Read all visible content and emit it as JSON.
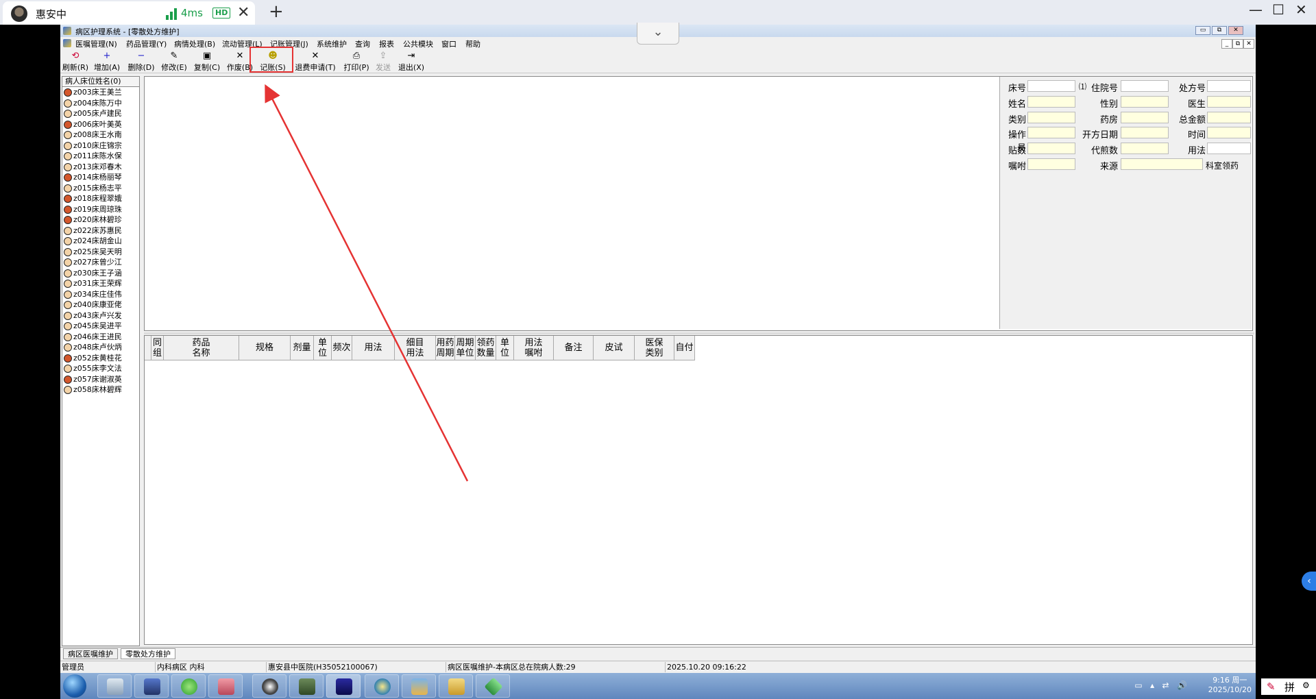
{
  "client": {
    "tab_title": "惠安中",
    "latency": "4ms",
    "quality": "HD",
    "close": "✕",
    "add": "+",
    "minimize": "—",
    "maximize": "☐",
    "close_window": "✕",
    "collapse": "⌄"
  },
  "window": {
    "title": "病区护理系统 - [零散处方维护]"
  },
  "menu": [
    "医嘱管理(N)",
    "药品管理(Y)",
    "病情处理(B)",
    "流动管理(L)",
    "记账管理(J)",
    "系统维护",
    "查询",
    "报表",
    "公共模块",
    "窗口",
    "帮助"
  ],
  "toolbar": [
    {
      "label": "刷新(R)",
      "icon": "⟲",
      "enabled": true
    },
    {
      "label": "增加(A)",
      "icon": "+",
      "enabled": true
    },
    {
      "label": "删除(D)",
      "icon": "−",
      "enabled": true
    },
    {
      "label": "修改(E)",
      "icon": "✎",
      "enabled": true
    },
    {
      "label": "复制(C)",
      "icon": "▣",
      "enabled": true
    },
    {
      "label": "作废(B)",
      "icon": "✕",
      "enabled": true
    },
    {
      "label": "记账(S)",
      "icon": "☻",
      "enabled": true
    },
    {
      "label": "退费申请(T)",
      "icon": "✕",
      "enabled": true
    },
    {
      "label": "打印(P)",
      "icon": "⎙",
      "enabled": true
    },
    {
      "label": "发送",
      "icon": "⇪",
      "enabled": false
    },
    {
      "label": "退出(X)",
      "icon": "⇥",
      "enabled": true
    }
  ],
  "patients": {
    "header": "病人床位姓名(0)",
    "items": [
      {
        "label": "z003床王美兰",
        "sex": "f"
      },
      {
        "label": "z004床陈万中",
        "sex": "m"
      },
      {
        "label": "z005床卢建民",
        "sex": "m"
      },
      {
        "label": "z006床叶美英",
        "sex": "f"
      },
      {
        "label": "z008床王水南",
        "sex": "m"
      },
      {
        "label": "z010床庄锦宗",
        "sex": "m"
      },
      {
        "label": "z011床陈水保",
        "sex": "m"
      },
      {
        "label": "z013床邓春木",
        "sex": "m"
      },
      {
        "label": "z014床杨丽琴",
        "sex": "f"
      },
      {
        "label": "z015床杨志平",
        "sex": "m"
      },
      {
        "label": "z018床程翠娥",
        "sex": "f"
      },
      {
        "label": "z019床周琼珠",
        "sex": "f"
      },
      {
        "label": "z020床林碧珍",
        "sex": "f"
      },
      {
        "label": "z022床苏惠民",
        "sex": "m"
      },
      {
        "label": "z024床胡金山",
        "sex": "m"
      },
      {
        "label": "z025床吴天明",
        "sex": "m"
      },
      {
        "label": "z027床曾少江",
        "sex": "m"
      },
      {
        "label": "z030床王子涵",
        "sex": "m"
      },
      {
        "label": "z031床王荣辉",
        "sex": "m"
      },
      {
        "label": "z034床庄佳伟",
        "sex": "m"
      },
      {
        "label": "z040床康亚佬",
        "sex": "m"
      },
      {
        "label": "z043床卢兴发",
        "sex": "m"
      },
      {
        "label": "z045床吴进平",
        "sex": "m"
      },
      {
        "label": "z046床王进民",
        "sex": "m"
      },
      {
        "label": "z048床卢伙炳",
        "sex": "m"
      },
      {
        "label": "z052床黄桂花",
        "sex": "f"
      },
      {
        "label": "z055床李文法",
        "sex": "m"
      },
      {
        "label": "z057床谢淑英",
        "sex": "f"
      },
      {
        "label": "z058床林碧辉",
        "sex": "m"
      }
    ]
  },
  "info_panel": {
    "bed_label": "床号",
    "bed_suffix": "⑴",
    "inpatient_label": "住院号",
    "rx_label": "处方号",
    "name_label": "姓名",
    "sex_label": "性别",
    "doctor_label": "医生",
    "type_label": "类别",
    "pharmacy_label": "药房",
    "total_label": "总金额",
    "operator_label": "操作员",
    "rx_date_label": "开方日期",
    "time_label": "时间",
    "doses_label": "贴数",
    "decoct_label": "代煎数",
    "usage_label": "用法",
    "advice_label": "嘱咐",
    "source_label": "来源",
    "dept_pickup": "科室领药"
  },
  "grid": {
    "columns": [
      "",
      "同组",
      "药品名称",
      "规格",
      "剂量",
      "单位",
      "频次",
      "用法",
      "细目用法",
      "用药周期",
      "周期单位",
      "领药数量",
      "单位",
      "用法嘱咐",
      "备注",
      "皮试",
      "医保类别",
      "自付"
    ]
  },
  "bottom_tabs": [
    "病区医嘱维护",
    "零散处方维护"
  ],
  "status": {
    "user": "管理员",
    "dept": "内科病区 内科",
    "hospital": "惠安县中医院(H35052100067)",
    "message": "病区医嘱维护-本病区总在院病人数:29",
    "datetime": "2025.10.20 09:16:22"
  },
  "taskbar": {
    "time": "9:16 周一",
    "date": "2025/10/20",
    "ime": "拼"
  },
  "colors": {
    "highlight": "#e53333",
    "field_yellow": "#ffffe0",
    "accent_green": "#1a9e4a"
  }
}
